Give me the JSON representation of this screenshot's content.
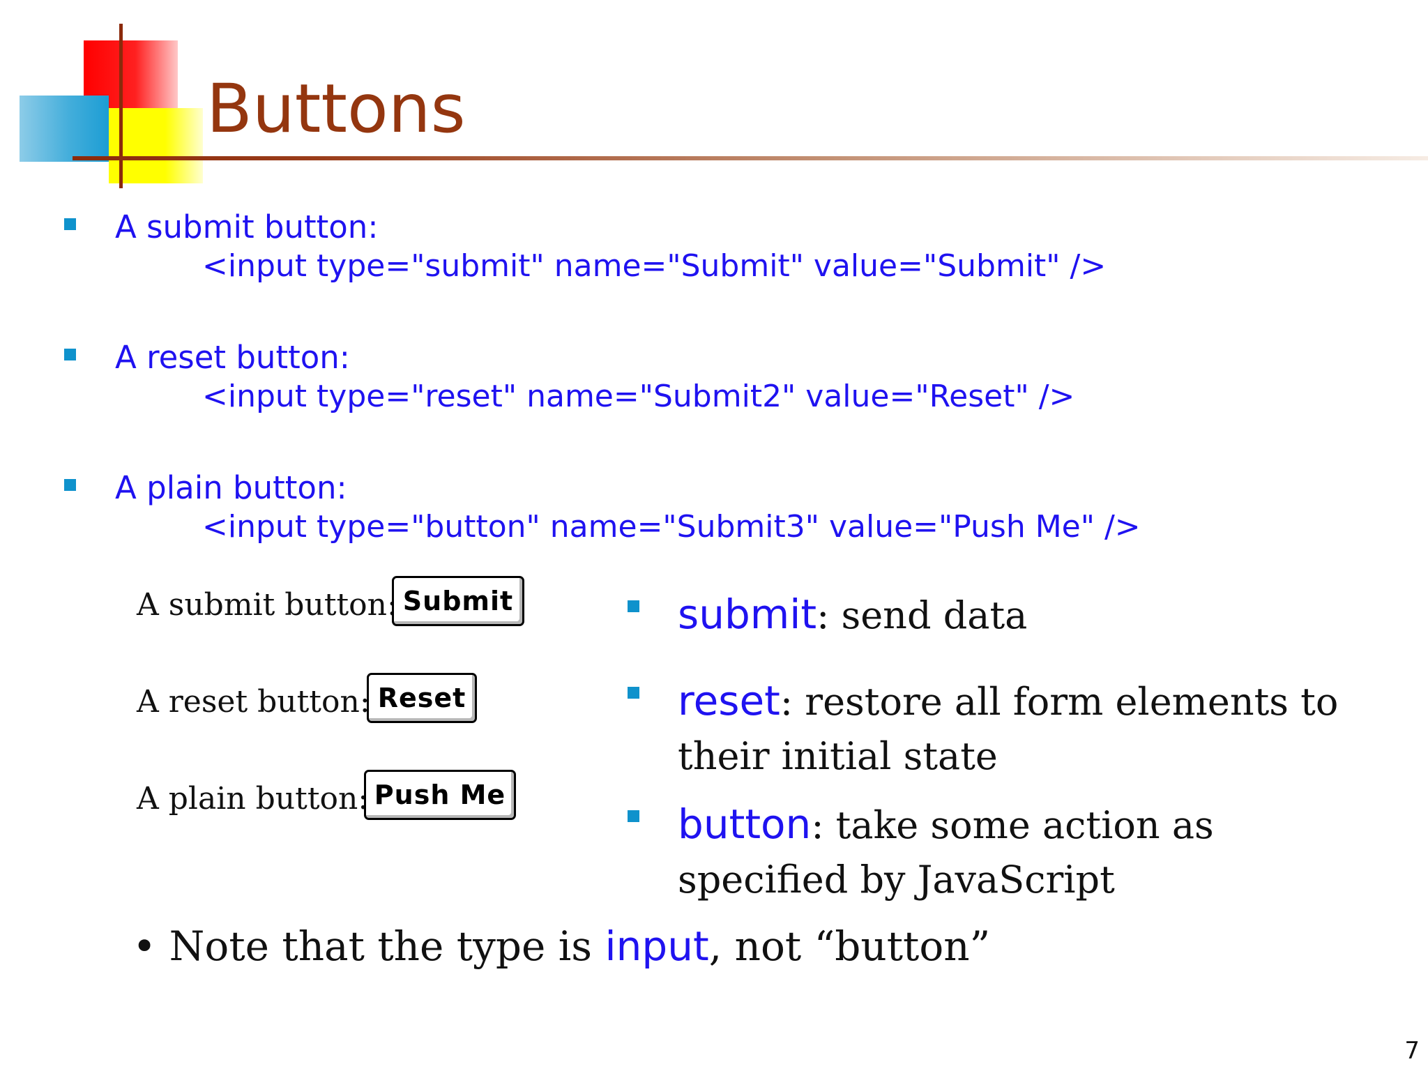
{
  "slide": {
    "title": "Buttons",
    "page_number": "7"
  },
  "bullets": [
    {
      "label": "A submit button:",
      "code": "<input type=\"submit\" name=\"Submit\" value=\"Submit\" />"
    },
    {
      "label": "A reset button:",
      "code": "<input type=\"reset\" name=\"Submit2\" value=\"Reset\" />"
    },
    {
      "label": "A plain button:",
      "code": "<input type=\"button\" name=\"Submit3\" value=\"Push Me\" />"
    }
  ],
  "demo": [
    {
      "label": "A submit button:",
      "button": "Submit"
    },
    {
      "label": "A reset button:",
      "button": "Reset"
    },
    {
      "label": "A plain button:",
      "button": "Push Me"
    }
  ],
  "explanations": [
    {
      "keyword": "submit",
      "text": ": send data",
      "continuation": ""
    },
    {
      "keyword": "reset",
      "text": ": restore all form elements to",
      "continuation": "their initial state"
    },
    {
      "keyword": "button",
      "text": ": take some action as",
      "continuation": "specified by JavaScript"
    }
  ],
  "note": {
    "prefix": "• Note that the type is ",
    "keyword": "input",
    "suffix": ", not “button”"
  },
  "colors": {
    "title": "#94360f",
    "code_blue": "#1f12f0",
    "bullet": "#0f92cc"
  }
}
